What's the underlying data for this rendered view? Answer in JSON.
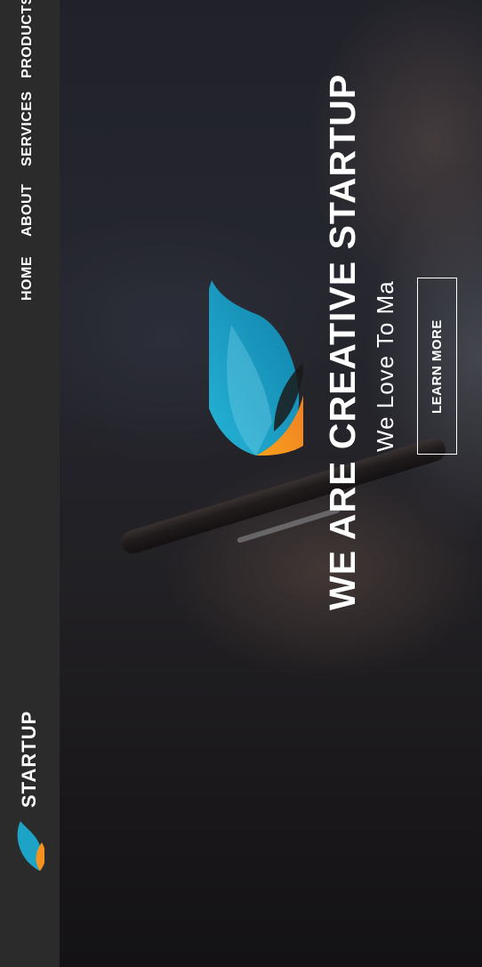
{
  "nav": {
    "brand": "STARTUP",
    "items": [
      {
        "label": "HOME"
      },
      {
        "label": "ABOUT"
      },
      {
        "label": "SERVICES"
      },
      {
        "label": "PRODUCTS"
      }
    ]
  },
  "hero": {
    "title": "WE ARE CREATIVE STARTUP",
    "subtitle": "We Love To Ma",
    "cta_label": "LEARN MORE"
  },
  "icons": {
    "logo": "flame-logo-icon"
  },
  "colors": {
    "sidebar_bg": "#2b2b2b",
    "logo_blue": "#1da3c6",
    "logo_orange": "#f5921f",
    "text": "#ffffff"
  }
}
